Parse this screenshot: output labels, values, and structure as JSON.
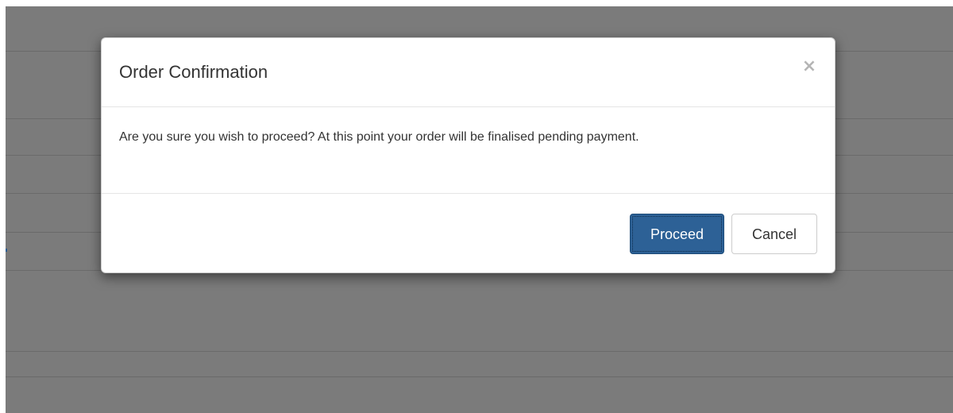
{
  "modal": {
    "title": "Order Confirmation",
    "close_label": "×",
    "message": "Are you sure you wish to proceed? At this point your order will be finalised pending payment.",
    "buttons": {
      "proceed_label": "Proceed",
      "cancel_label": "Cancel"
    }
  },
  "colors": {
    "backdrop": "#7b7b7b",
    "primary": "#2d6196",
    "modal_background": "#ffffff",
    "divider": "#e5e5e5"
  },
  "icons": {
    "close": "close-icon"
  }
}
